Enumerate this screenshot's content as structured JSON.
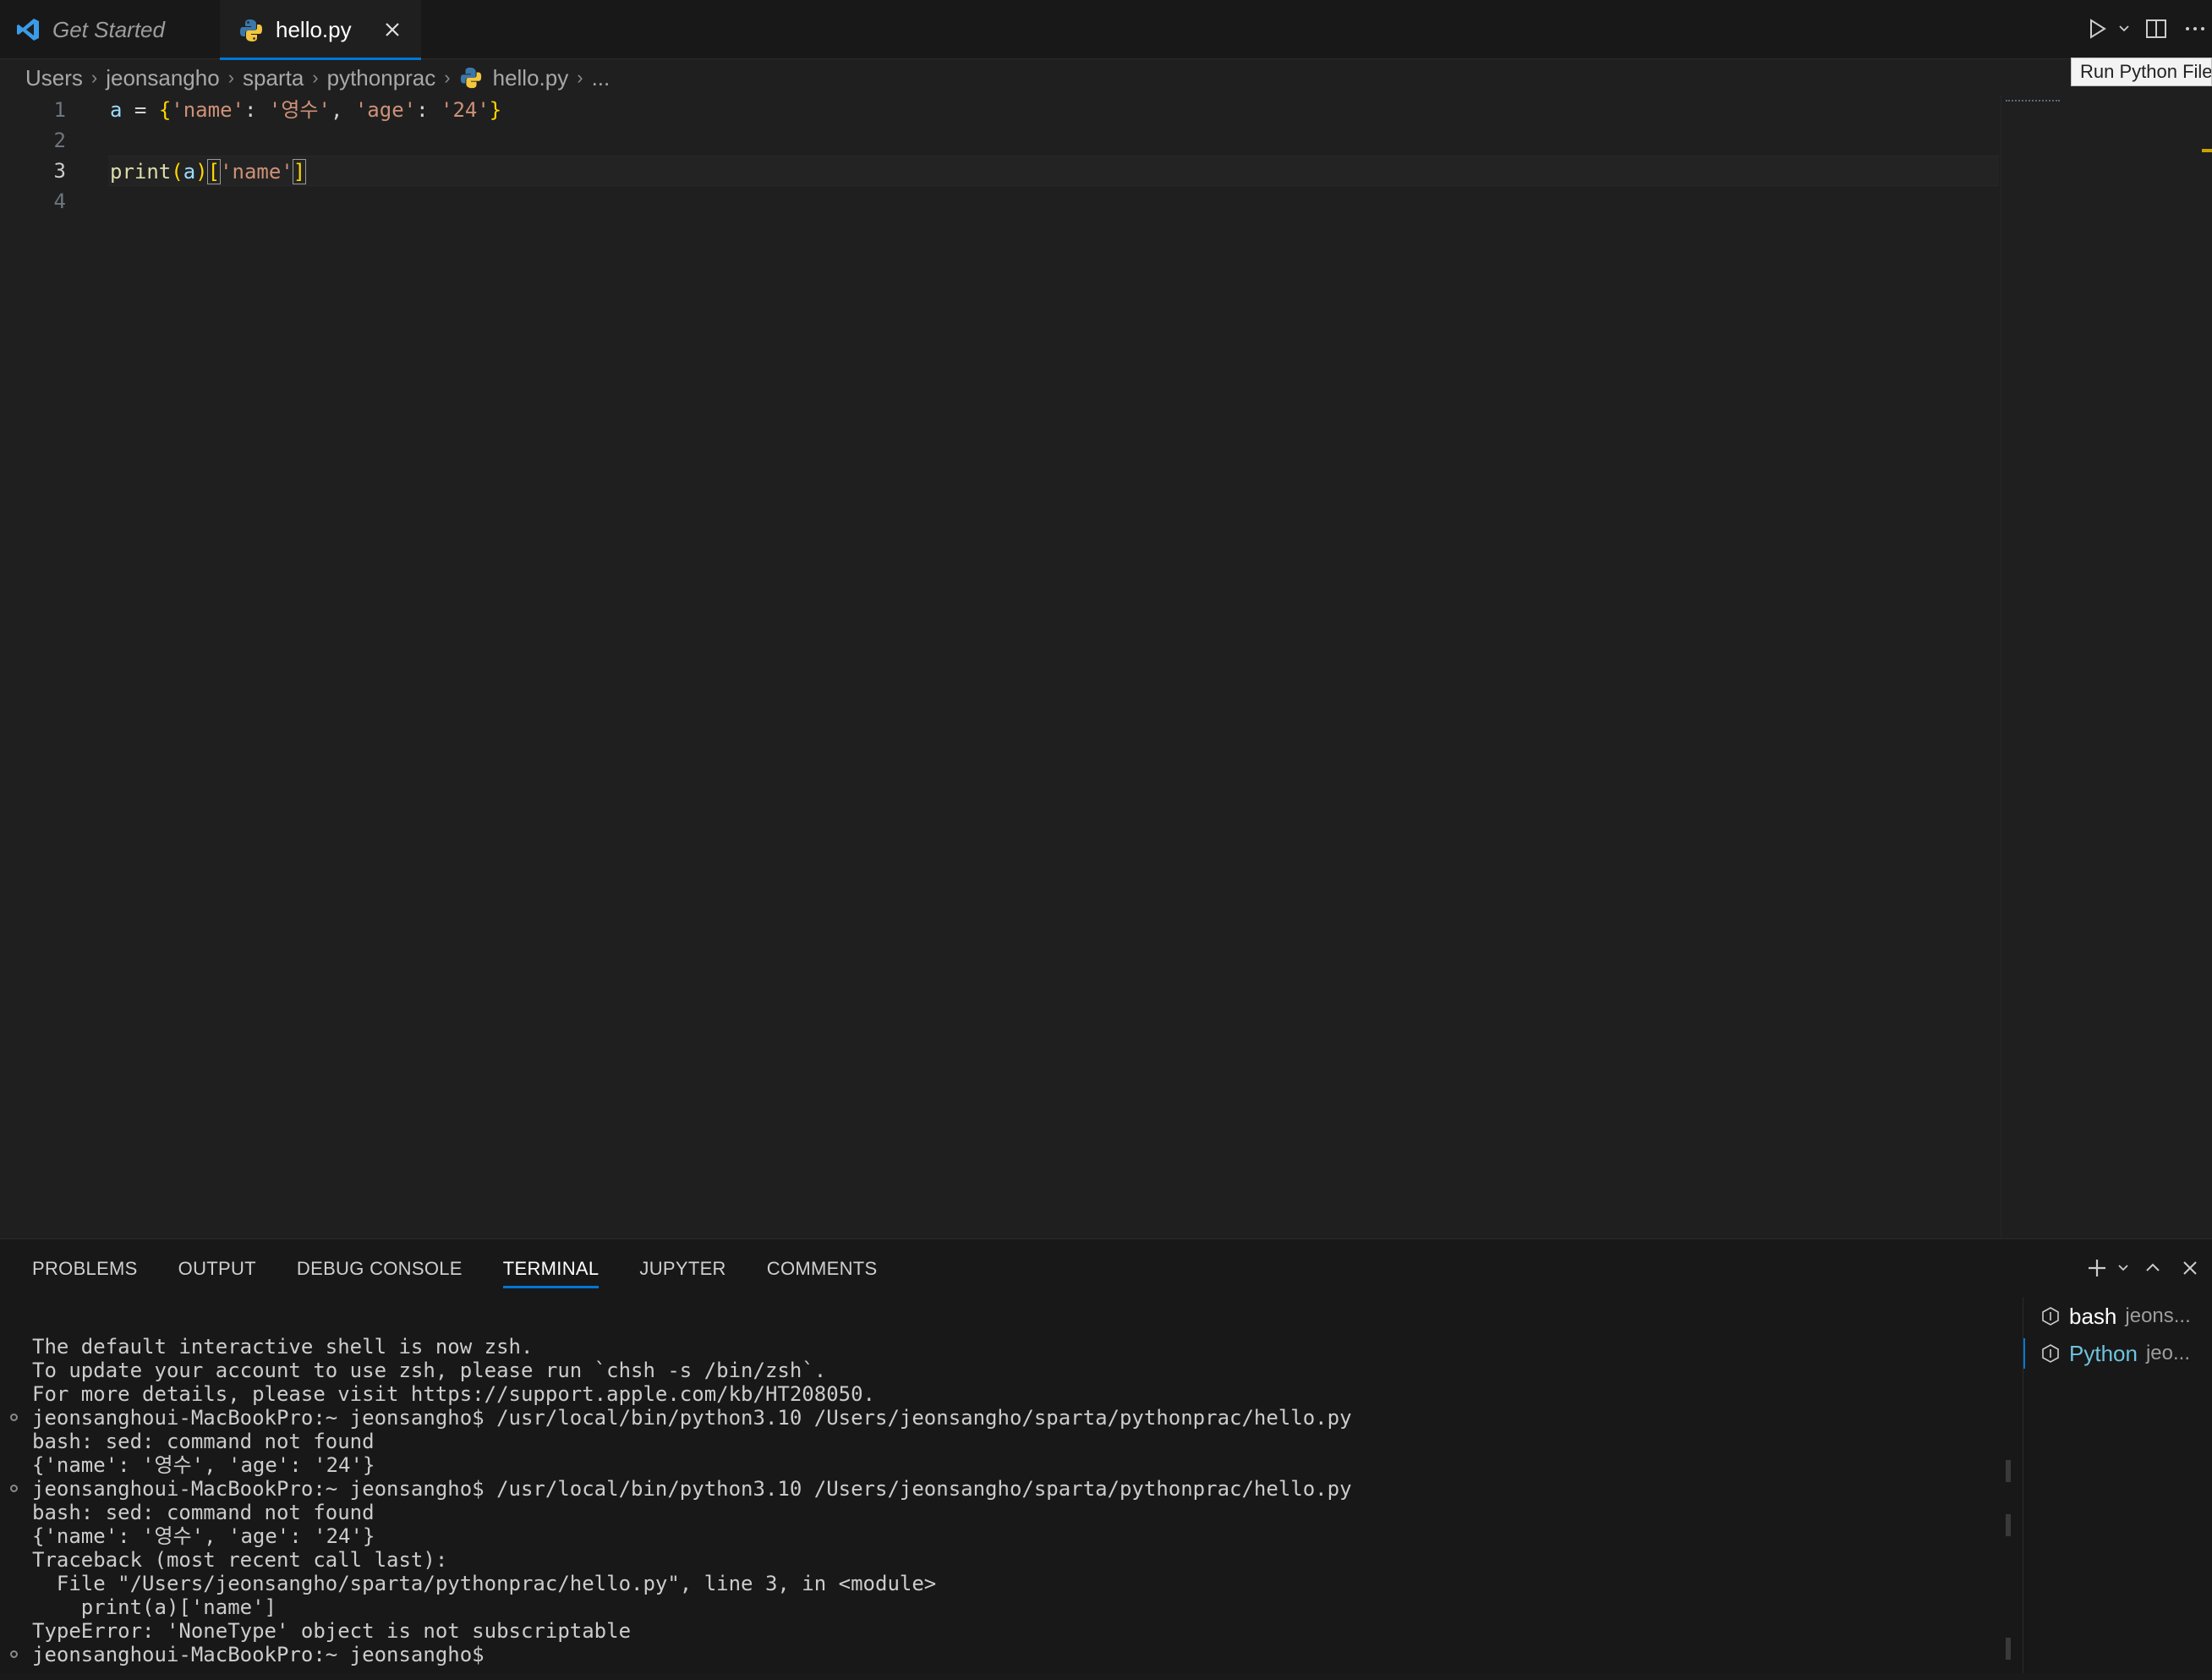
{
  "tabs": {
    "get_started": "Get Started",
    "active_file": "hello.py"
  },
  "tooltip": "Run Python File",
  "breadcrumb": {
    "items": [
      "Users",
      "jeonsangho",
      "sparta",
      "pythonprac",
      "hello.py",
      "..."
    ]
  },
  "editor": {
    "line_numbers": [
      "1",
      "2",
      "3",
      "4"
    ],
    "line1": {
      "var": "a",
      "eq": " = ",
      "lbrace": "{",
      "k1": "'name'",
      "c1": ": ",
      "v1": "'영수'",
      "comma": ", ",
      "k2": "'age'",
      "c2": ": ",
      "v2": "'24'",
      "rbrace": "}"
    },
    "line3": {
      "fn": "print",
      "lp": "(",
      "arg": "a",
      "rp": ")",
      "lb": "[",
      "key": "'name'",
      "rb": "]"
    }
  },
  "panel": {
    "tabs": [
      "PROBLEMS",
      "OUTPUT",
      "DEBUG CONSOLE",
      "TERMINAL",
      "JUPYTER",
      "COMMENTS"
    ],
    "active_tab": "TERMINAL"
  },
  "terminal": {
    "lines": [
      "The default interactive shell is now zsh.",
      "To update your account to use zsh, please run `chsh -s /bin/zsh`.",
      "For more details, please visit https://support.apple.com/kb/HT208050.",
      "jeonsanghoui-MacBookPro:~ jeonsangho$ /usr/local/bin/python3.10 /Users/jeonsangho/sparta/pythonprac/hello.py",
      "bash: sed: command not found",
      "{'name': '영수', 'age': '24'}",
      "jeonsanghoui-MacBookPro:~ jeonsangho$ /usr/local/bin/python3.10 /Users/jeonsangho/sparta/pythonprac/hello.py",
      "bash: sed: command not found",
      "{'name': '영수', 'age': '24'}",
      "Traceback (most recent call last):",
      "  File \"/Users/jeonsangho/sparta/pythonprac/hello.py\", line 3, in <module>",
      "    print(a)['name']",
      "TypeError: 'NoneType' object is not subscriptable",
      "jeonsanghoui-MacBookPro:~ jeonsangho$ "
    ],
    "instances": [
      {
        "name": "bash",
        "sub": "jeons..."
      },
      {
        "name": "Python",
        "sub": "jeo..."
      }
    ]
  },
  "colors": {
    "accent": "#0078d4",
    "editor_bg": "#1f1f1f",
    "panel_bg": "#181818"
  }
}
